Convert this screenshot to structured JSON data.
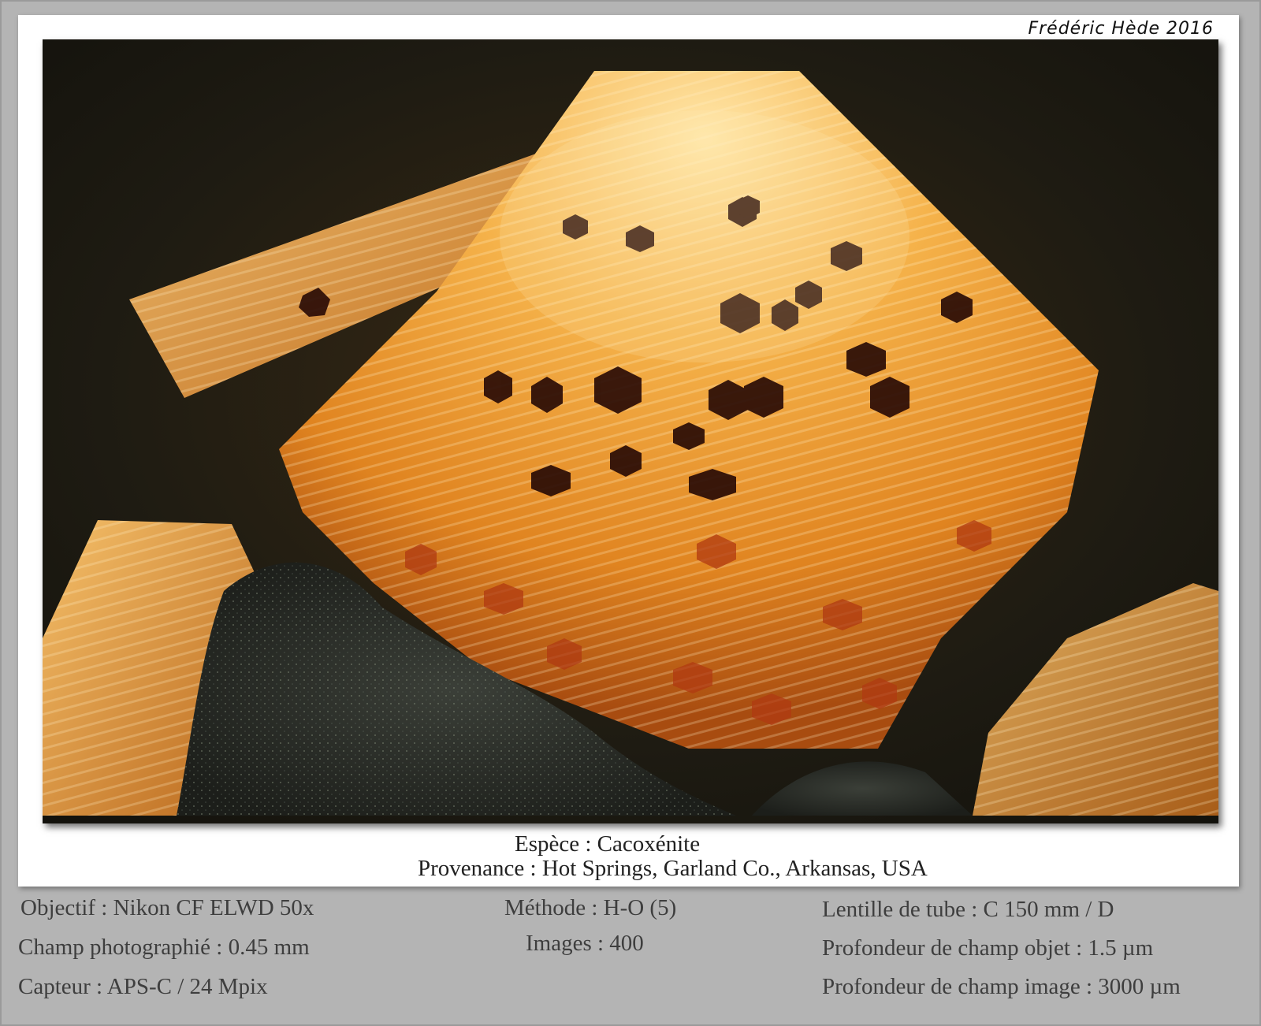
{
  "signature": "Frédéric Hède 2016",
  "photo": {
    "subject": "macro-photo-cacoxenite-crystals",
    "colors": {
      "background": "#1e1b12",
      "crystal_orange": "#f0a030",
      "crystal_highlight": "#ffd27a",
      "dark_inclusions": "#2a0c06",
      "matrix": "#2b2e2a"
    }
  },
  "caption": {
    "species": "Espèce : Cacoxénite",
    "origin": "Provenance : Hot Springs, Garland Co., Arkansas, USA"
  },
  "metadata": {
    "col1": [
      "Objectif : Nikon CF ELWD 50x",
      "Champ photographié : 0.45 mm",
      "Capteur : APS-C / 24 Mpix"
    ],
    "col2": [
      "Méthode : H-O (5)",
      "Images : 400"
    ],
    "col3": [
      "Lentille de tube : C 150 mm / D",
      "Profondeur de champ objet : 1.5 µm",
      "Profondeur de champ image : 3000 µm"
    ]
  }
}
